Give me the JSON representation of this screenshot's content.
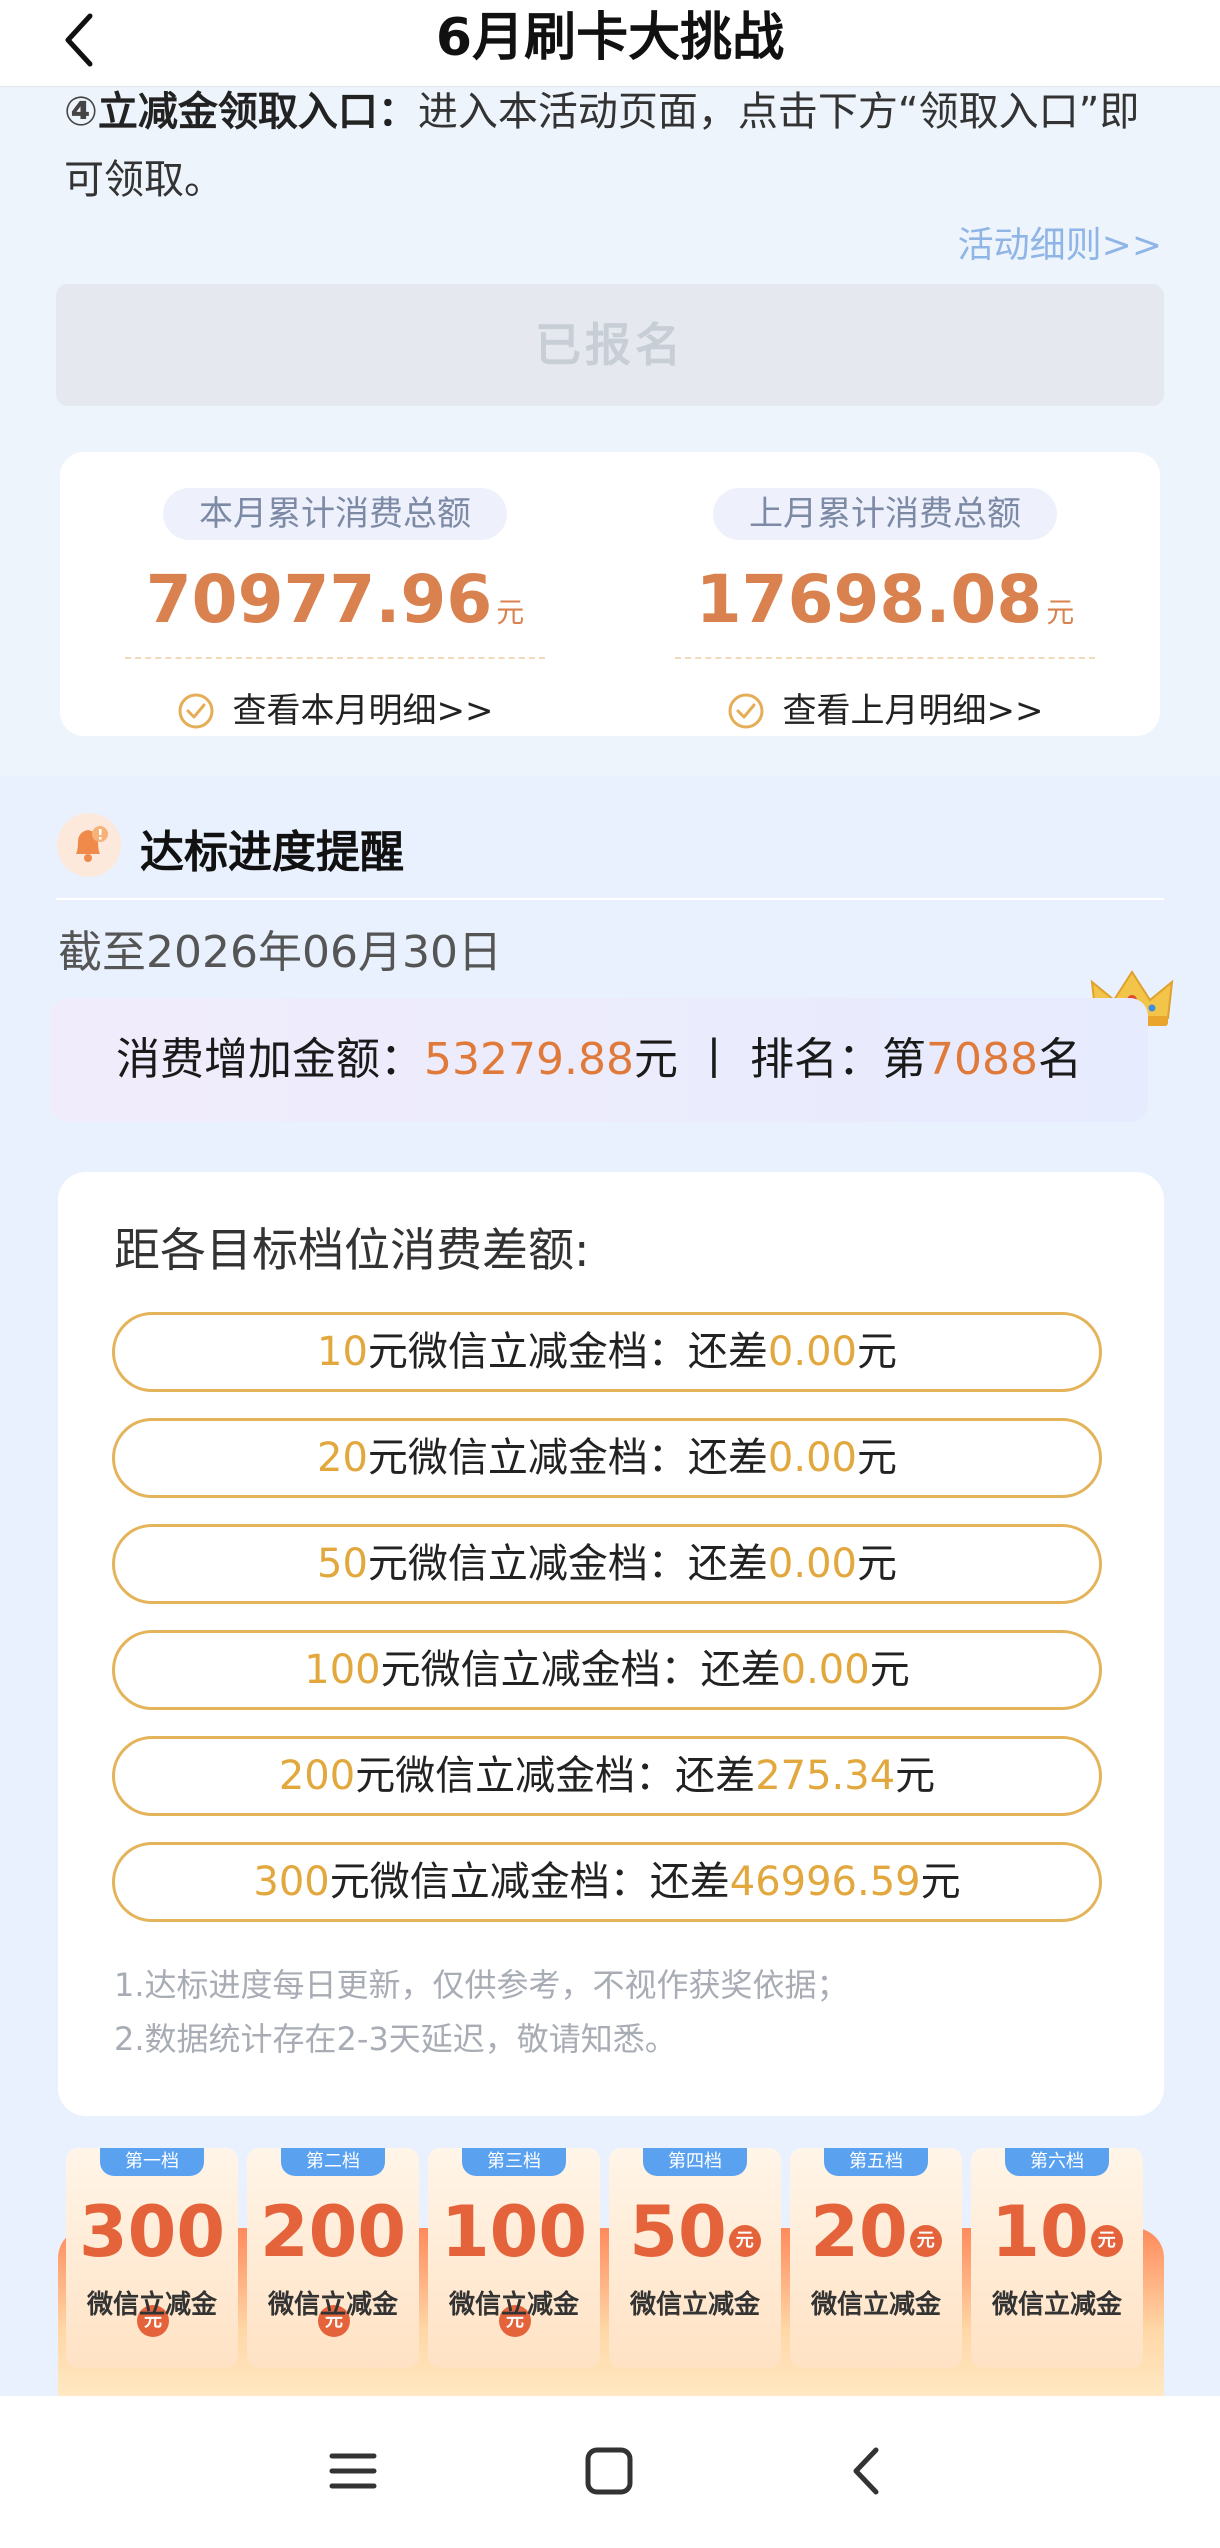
{
  "navbar": {
    "title": "6月刷卡大挑战",
    "back_icon": "chevron-left-icon"
  },
  "rules": {
    "item_num": "④",
    "item_key": "立减金领取入口：",
    "item_text": "进入本活动页面，点击下方“领取入口”即可领取。",
    "link": "活动细则>>"
  },
  "signup_button": "已报名",
  "totals": {
    "this_month": {
      "label": "本月累计消费总额",
      "amount": "70977.96",
      "unit": "元",
      "link": "查看本月明细>>"
    },
    "last_month": {
      "label": "上月累计消费总额",
      "amount": "17698.08",
      "unit": "元",
      "link": "查看上月明细>>"
    }
  },
  "progress": {
    "title": "达标进度提醒",
    "date": "截至2026年06月30日",
    "increase_label": "消费增加金额：",
    "increase_amount": "53279.88",
    "increase_unit": "元",
    "separator": "丨",
    "rank_label": "排名：第",
    "rank_value": "7088",
    "rank_unit": "名"
  },
  "targets": {
    "title": "距各目标档位消费差额:",
    "tier_text": "元微信立减金档：还差",
    "unit": "元",
    "tiers": [
      {
        "value": "10",
        "remaining": "0.00"
      },
      {
        "value": "20",
        "remaining": "0.00"
      },
      {
        "value": "50",
        "remaining": "0.00"
      },
      {
        "value": "100",
        "remaining": "0.00"
      },
      {
        "value": "200",
        "remaining": "275.34"
      },
      {
        "value": "300",
        "remaining": "46996.59"
      }
    ],
    "notes": [
      "1.达标进度每日更新，仅供参考，不视作获奖依据；",
      "2.数据统计存在2-3天延迟，敬请知悉。"
    ]
  },
  "prizes": {
    "yuan": "元",
    "label": "微信立减金",
    "items": [
      {
        "tag": "第一档",
        "value": "300"
      },
      {
        "tag": "第二档",
        "value": "200"
      },
      {
        "tag": "第三档",
        "value": "100"
      },
      {
        "tag": "第四档",
        "value": "50"
      },
      {
        "tag": "第五档",
        "value": "20"
      },
      {
        "tag": "第六档",
        "value": "10"
      }
    ]
  },
  "colors": {
    "accent_orange": "#e07a3a",
    "gold": "#e2a83e",
    "link_blue": "#8fb5e6"
  }
}
